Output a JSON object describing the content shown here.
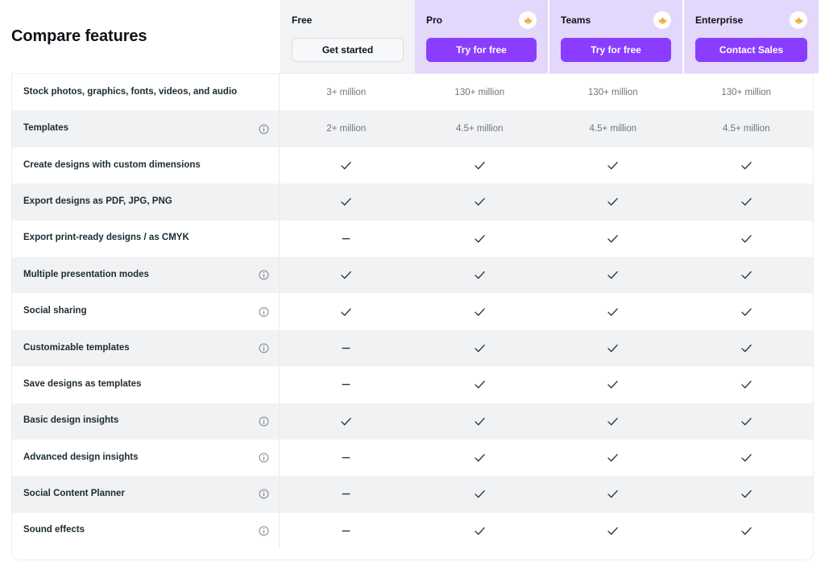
{
  "header": {
    "title": "Compare features",
    "plans": [
      {
        "name": "Free",
        "cta": "Get started",
        "style": "outline",
        "crown": false,
        "crown_icon": "crown-icon"
      },
      {
        "name": "Pro",
        "cta": "Try for free",
        "style": "solid",
        "crown": true,
        "crown_icon": "crown-icon"
      },
      {
        "name": "Teams",
        "cta": "Try for free",
        "style": "solid",
        "crown": true,
        "crown_icon": "crown-icon"
      },
      {
        "name": "Enterprise",
        "cta": "Contact Sales",
        "style": "solid",
        "crown": true,
        "crown_icon": "crown-icon"
      }
    ]
  },
  "colors": {
    "brand_purple": "#8b3dff",
    "paid_header_bg": "#e3d7fb",
    "free_header_bg": "#f2f3f5",
    "row_alt_bg": "#f1f2f4",
    "crown_gold": "#f2a93b",
    "text_dark": "#0e1318",
    "text_muted": "#6e7479"
  },
  "table": {
    "columns": [
      "Free",
      "Pro",
      "Teams",
      "Enterprise"
    ],
    "rows": [
      {
        "feature": "Stock photos, graphics, fonts, videos, and audio",
        "info": false,
        "values": [
          "3+ million",
          "130+ million",
          "130+ million",
          "130+ million"
        ]
      },
      {
        "feature": "Templates",
        "info": true,
        "info_icon": "info-icon",
        "values": [
          "2+ million",
          "4.5+ million",
          "4.5+ million",
          "4.5+ million"
        ]
      },
      {
        "feature": "Create designs with custom dimensions",
        "info": false,
        "values": [
          "check",
          "check",
          "check",
          "check"
        ]
      },
      {
        "feature": "Export designs as PDF, JPG, PNG",
        "info": false,
        "values": [
          "check",
          "check",
          "check",
          "check"
        ]
      },
      {
        "feature": "Export print-ready designs / as CMYK",
        "info": false,
        "values": [
          "dash",
          "check",
          "check",
          "check"
        ]
      },
      {
        "feature": "Multiple presentation modes",
        "info": true,
        "info_icon": "info-icon",
        "values": [
          "check",
          "check",
          "check",
          "check"
        ]
      },
      {
        "feature": "Social sharing",
        "info": true,
        "info_icon": "info-icon",
        "values": [
          "check",
          "check",
          "check",
          "check"
        ]
      },
      {
        "feature": "Customizable templates",
        "info": true,
        "info_icon": "info-icon",
        "values": [
          "dash",
          "check",
          "check",
          "check"
        ]
      },
      {
        "feature": "Save designs as templates",
        "info": false,
        "values": [
          "dash",
          "check",
          "check",
          "check"
        ]
      },
      {
        "feature": "Basic design insights",
        "info": true,
        "info_icon": "info-icon",
        "values": [
          "check",
          "check",
          "check",
          "check"
        ]
      },
      {
        "feature": "Advanced design insights",
        "info": true,
        "info_icon": "info-icon",
        "values": [
          "dash",
          "check",
          "check",
          "check"
        ]
      },
      {
        "feature": "Social Content Planner",
        "info": true,
        "info_icon": "info-icon",
        "values": [
          "dash",
          "check",
          "check",
          "check"
        ]
      },
      {
        "feature": "Sound effects",
        "info": true,
        "info_icon": "info-icon",
        "values": [
          "dash",
          "check",
          "check",
          "check"
        ]
      }
    ]
  }
}
